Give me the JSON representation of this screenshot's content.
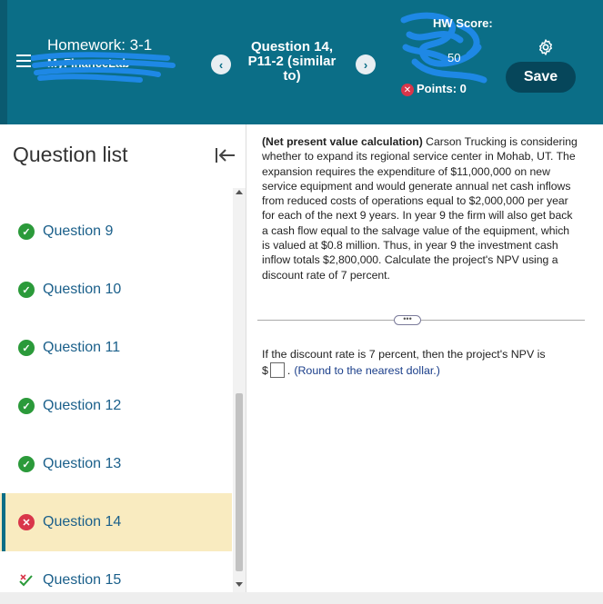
{
  "header": {
    "homework_title": "Homework: 3-1",
    "homework_subtitle": "MyFinanceLab",
    "question_title": "Question 14, P11-2 (similar to)",
    "prev_label": "‹",
    "next_label": "›",
    "score_label": "HW Score:",
    "score_value": "50",
    "points_label": "Points: 0",
    "save_label": "Save",
    "colors": {
      "bar": "#0b6e87",
      "save": "#06465a",
      "scribble": "#1e88e5"
    }
  },
  "sidebar": {
    "title": "Question list",
    "questions": [
      {
        "label": "Question 9",
        "status": "correct",
        "icon": "check-icon"
      },
      {
        "label": "Question 10",
        "status": "correct",
        "icon": "check-icon"
      },
      {
        "label": "Question 11",
        "status": "correct",
        "icon": "check-icon"
      },
      {
        "label": "Question 12",
        "status": "correct",
        "icon": "check-icon"
      },
      {
        "label": "Question 13",
        "status": "correct",
        "icon": "check-icon"
      },
      {
        "label": "Question 14",
        "status": "incorrect",
        "icon": "x-icon",
        "active": true
      },
      {
        "label": "Question 15",
        "status": "partial",
        "icon": "partial-check-icon"
      }
    ]
  },
  "problem": {
    "heading": "(Net present value calculation)",
    "body": "Carson Trucking is considering whether to expand its regional service center in Mohab, UT. The expansion requires the expenditure of $11,000,000 on new service equipment and would generate annual net cash inflows from reduced costs of operations equal to $2,000,000 per year for each of the next 9 years. In year 9 the firm will also get back a cash flow equal to the salvage value of the equipment, which is valued at $0.8 million. Thus, in year 9 the investment cash inflow totals $2,800,000. Calculate the project's NPV using a discount rate of 7 percent.",
    "more_label": "•••",
    "answer_prompt": "If the discount rate is 7 percent, then the project's NPV is",
    "currency": "$",
    "answer_value": "",
    "period": ".",
    "hint": "(Round to the nearest dollar.)"
  }
}
